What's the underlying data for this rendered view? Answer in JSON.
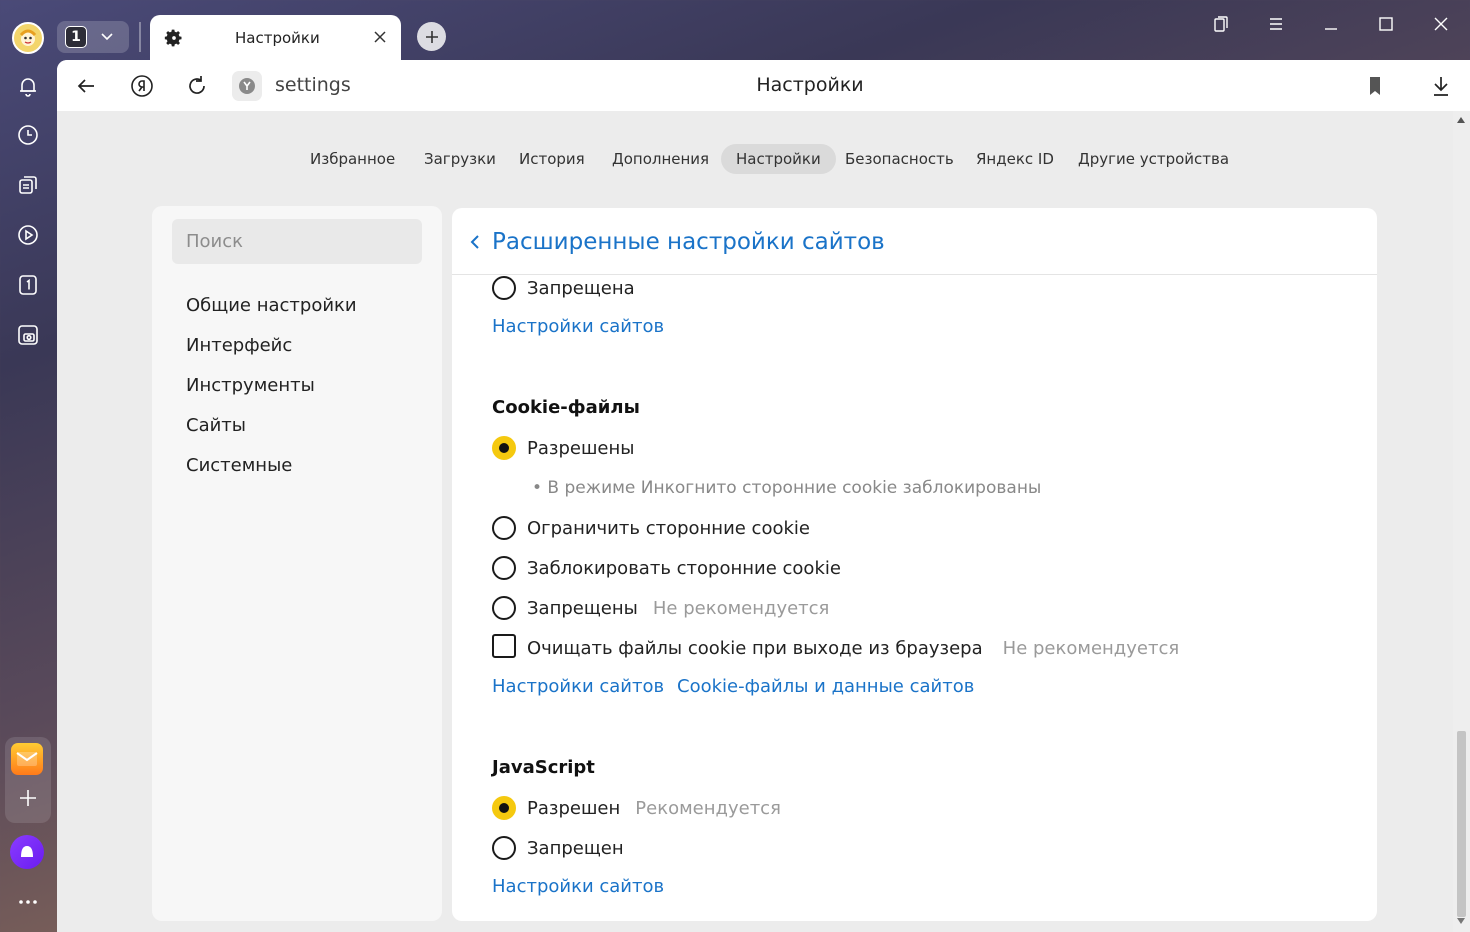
{
  "window": {
    "tab_count": "1",
    "tab_title": "Настройки"
  },
  "toolbar": {
    "url": "settings",
    "page_title": "Настройки"
  },
  "nav_tabs": [
    {
      "label": "Избранное"
    },
    {
      "label": "Загрузки"
    },
    {
      "label": "История"
    },
    {
      "label": "Дополнения"
    },
    {
      "label": "Настройки",
      "active": true
    },
    {
      "label": "Безопасность"
    },
    {
      "label": "Яндекс ID"
    },
    {
      "label": "Другие устройства"
    }
  ],
  "sidebar": {
    "search_placeholder": "Поиск",
    "items": [
      {
        "label": "Общие настройки"
      },
      {
        "label": "Интерфейс"
      },
      {
        "label": "Инструменты"
      },
      {
        "label": "Сайты"
      },
      {
        "label": "Системные"
      }
    ]
  },
  "panel": {
    "title": "Расширенные настройки сайтов",
    "prev_section": {
      "option_label": "Запрещена",
      "link": "Настройки сайтов"
    },
    "cookies": {
      "title": "Cookie-файлы",
      "allowed": "Разрешены",
      "incognito_note": "• В режиме Инкогнито сторонние cookie заблокированы",
      "limit": "Ограничить сторонние cookie",
      "block": "Заблокировать сторонние cookie",
      "forbidden": "Запрещены",
      "forbidden_note": "Не рекомендуется",
      "clear_on_exit": "Очищать файлы cookie при выходе из браузера",
      "clear_note": "Не рекомендуется",
      "link_sites": "Настройки сайтов",
      "link_data": "Cookie-файлы и данные сайтов",
      "selected": "allowed"
    },
    "javascript": {
      "title": "JavaScript",
      "allowed": "Разрешен",
      "allowed_note": "Рекомендуется",
      "forbidden": "Запрещен",
      "link": "Настройки сайтов",
      "selected": "allowed"
    }
  },
  "colors": {
    "accent_link": "#1a73c8",
    "radio_selected": "#f5c90f"
  }
}
